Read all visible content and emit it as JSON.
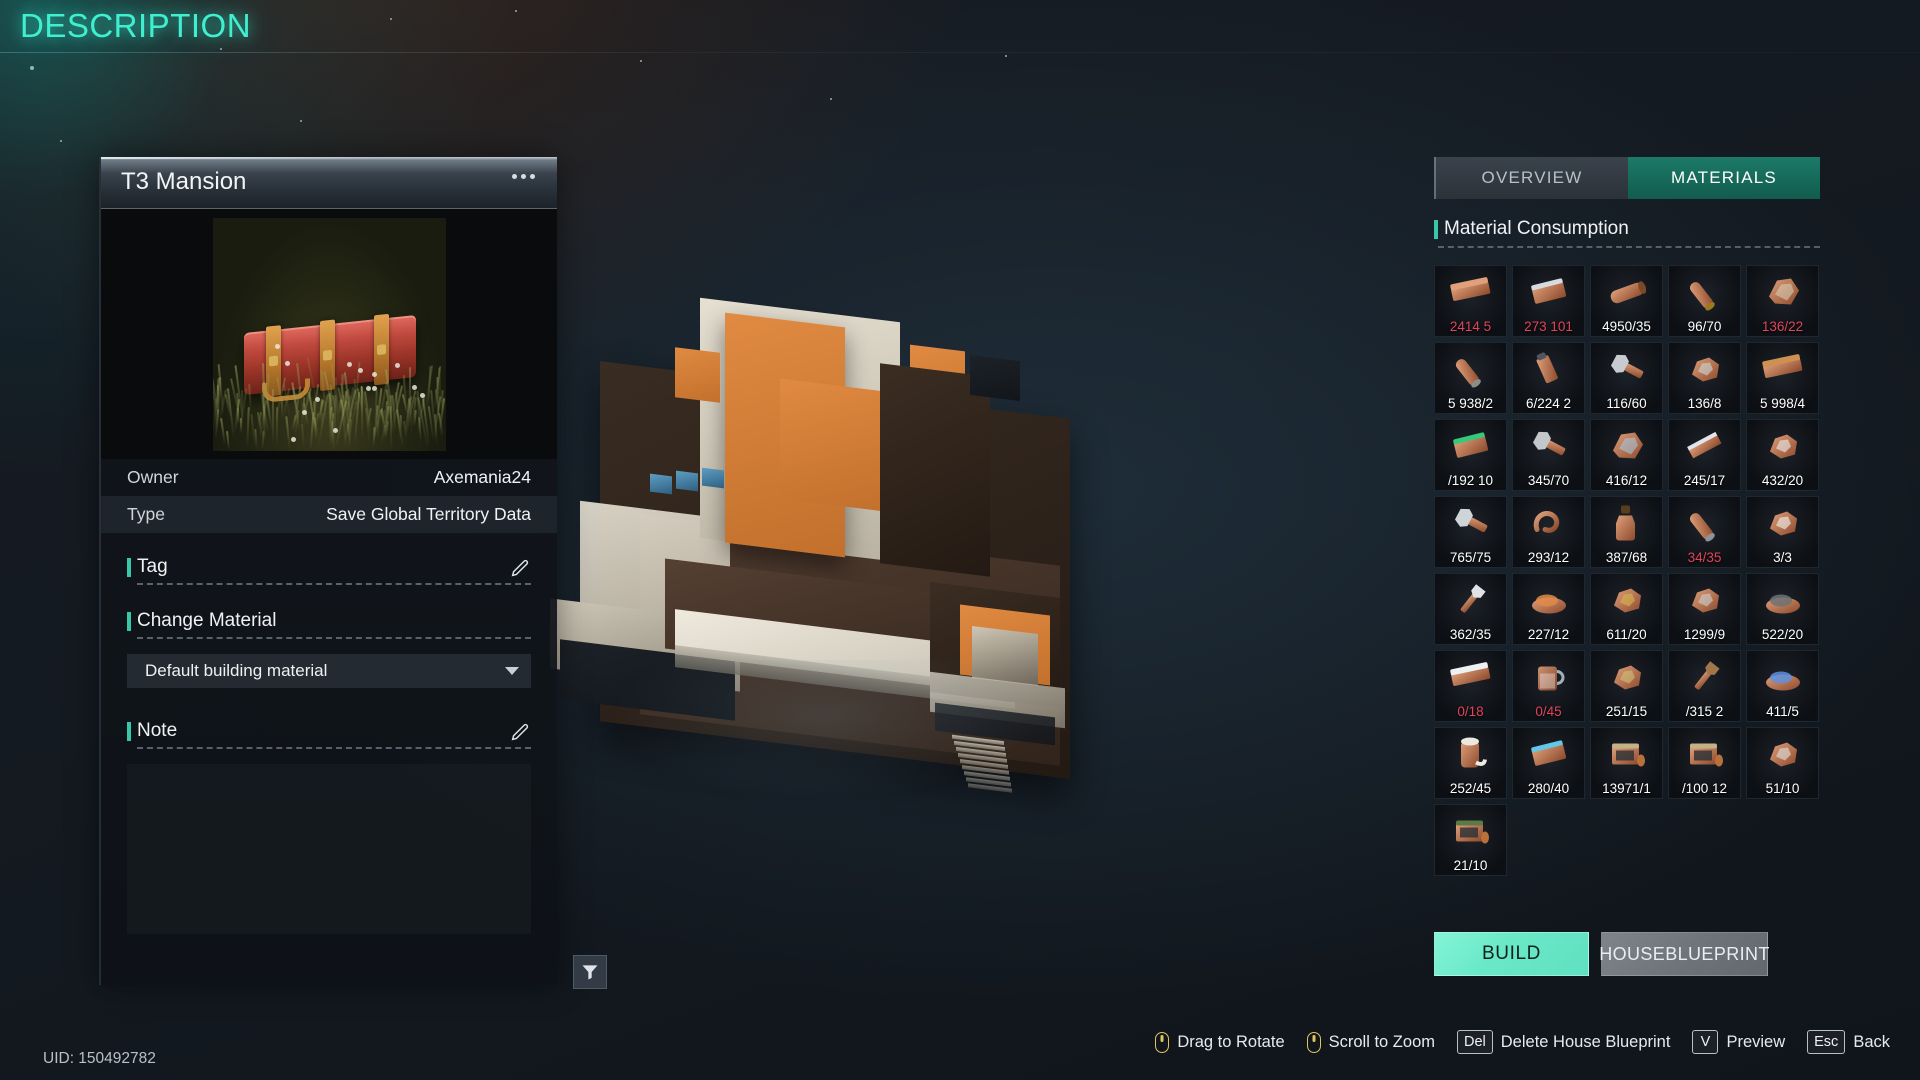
{
  "page": {
    "title": "DESCRIPTION",
    "uid": "UID: 150492782",
    "accent_teal": "#3ff0d0",
    "accent_green": "#38c7a9",
    "low_stock_color": "#e0455c"
  },
  "left_panel": {
    "title": "T3 Mansion",
    "more_icon": "ellipsis-icon",
    "thumbnail_icon": "red-crate-item-image",
    "info_rows": [
      {
        "key": "Owner",
        "value": "Axemania24"
      },
      {
        "key": "Type",
        "value": "Save Global Territory Data"
      }
    ],
    "tag": {
      "label": "Tag",
      "value": "",
      "edit_icon": "pencil-icon"
    },
    "change_material": {
      "label": "Change Material",
      "selected": "Default building material",
      "chevron": "chevron-down-icon"
    },
    "note": {
      "label": "Note",
      "value": "",
      "edit_icon": "pencil-icon"
    },
    "filter_button": {
      "icon": "filter-funnel-icon"
    }
  },
  "right_panel": {
    "tabs": [
      {
        "label": "OVERVIEW",
        "active": false
      },
      {
        "label": "MATERIALS",
        "active": true
      }
    ],
    "section_title": "Material Consumption",
    "materials": [
      {
        "icon": "copper-ingot-icon",
        "qty": "2414  5",
        "low": true,
        "color1": "#e0a07a",
        "color2": "#8c4a2c",
        "shape": "brick"
      },
      {
        "icon": "steel-plate-icon",
        "qty": "273  101",
        "low": true,
        "color1": "#d8dade",
        "color2": "#8f949a",
        "shape": "plate"
      },
      {
        "icon": "wood-log-icon",
        "qty": "4950/35",
        "low": false,
        "color1": "#c78456",
        "color2": "#7a4a26",
        "shape": "log"
      },
      {
        "icon": "brass-rod-icon",
        "qty": "96/70",
        "low": false,
        "color1": "#f0cf6a",
        "color2": "#9a7a1e",
        "shape": "rod"
      },
      {
        "icon": "cloth-fabric-icon",
        "qty": "136/22",
        "low": true,
        "color1": "#d9d6bd",
        "color2": "#8e8b72",
        "shape": "cloth"
      },
      {
        "icon": "aluminum-pipe-icon",
        "qty": "5  938/2",
        "low": false,
        "color1": "#d5d6cf",
        "color2": "#8b8d86",
        "shape": "rod"
      },
      {
        "icon": "grease-tube-icon",
        "qty": "6/224  2",
        "low": false,
        "color1": "#b9c3cb",
        "color2": "#4e565e",
        "shape": "tube"
      },
      {
        "icon": "bolt-icon",
        "qty": "116/60",
        "low": false,
        "color1": "#c8ccd1",
        "color2": "#6e747a",
        "shape": "bolt"
      },
      {
        "icon": "ore-crystal-icon",
        "qty": "136/8",
        "low": false,
        "color1": "#cdd8dc",
        "color2": "#4c5458",
        "shape": "nugget"
      },
      {
        "icon": "bronze-ingot-icon",
        "qty": "5  998/4",
        "low": false,
        "color1": "#cf9152",
        "color2": "#7d4e20",
        "shape": "brick"
      },
      {
        "icon": "circuit-board-icon",
        "qty": "/192  10",
        "low": false,
        "color1": "#36c97b",
        "color2": "#12603a",
        "shape": "plate"
      },
      {
        "icon": "nut-and-bolt-icon",
        "qty": "345/70",
        "low": false,
        "color1": "#c2c7cc",
        "color2": "#666c72",
        "shape": "bolt"
      },
      {
        "icon": "blue-tarp-roll-icon",
        "qty": "416/12",
        "low": false,
        "color1": "#a9cce6",
        "color2": "#4a6d8c",
        "shape": "cloth"
      },
      {
        "icon": "steel-beam-icon",
        "qty": "245/17",
        "low": false,
        "color1": "#e2e6ea",
        "color2": "#878d93",
        "shape": "beam"
      },
      {
        "icon": "silver-scrap-icon",
        "qty": "432/20",
        "low": false,
        "color1": "#eceff2",
        "color2": "#9aa0a6",
        "shape": "nugget"
      },
      {
        "icon": "hinge-bracket-icon",
        "qty": "765/75",
        "low": false,
        "color1": "#cfd4d9",
        "color2": "#6a7076",
        "shape": "bolt"
      },
      {
        "icon": "rubber-hose-icon",
        "qty": "293/12",
        "low": false,
        "color1": "#9aa2a9",
        "color2": "#3e464c",
        "shape": "hose"
      },
      {
        "icon": "chemical-bottle-icon",
        "qty": "387/68",
        "low": false,
        "color1": "#a8763c",
        "color2": "#5a3d1c",
        "shape": "bottle"
      },
      {
        "icon": "titanium-rod-icon",
        "qty": "34/35",
        "low": true,
        "color1": "#e6e9ec",
        "color2": "#8d9399",
        "shape": "rod"
      },
      {
        "icon": "quartz-crystal-icon",
        "qty": "3/3",
        "low": false,
        "color1": "#f3f5f7",
        "color2": "#b6bcc2",
        "shape": "nugget"
      },
      {
        "icon": "wrench-tool-icon",
        "qty": "362/35",
        "low": false,
        "color1": "#dfe3e7",
        "color2": "#7c8288",
        "shape": "tool"
      },
      {
        "icon": "copper-powder-icon",
        "qty": "227/12",
        "low": false,
        "color1": "#e08a4a",
        "color2": "#8c4e1c",
        "shape": "powder"
      },
      {
        "icon": "gold-ore-icon",
        "qty": "611/20",
        "low": false,
        "color1": "#d8b84e",
        "color2": "#6e5a18",
        "shape": "nugget"
      },
      {
        "icon": "stone-icon",
        "qty": "1299/9",
        "low": false,
        "color1": "#ccd2d4",
        "color2": "#7d8386",
        "shape": "nugget"
      },
      {
        "icon": "coal-icon",
        "qty": "522/20",
        "low": false,
        "color1": "#6c7276",
        "color2": "#1c2024",
        "shape": "powder"
      },
      {
        "icon": "metal-ingot-icon",
        "qty": "0/18",
        "low": true,
        "color1": "#eef1f4",
        "color2": "#9ba1a7",
        "shape": "brick"
      },
      {
        "icon": "water-mug-icon",
        "qty": "0/45",
        "low": true,
        "color1": "#dfe8ee",
        "color2": "#9fb0bc",
        "shape": "mug"
      },
      {
        "icon": "sulfur-ore-icon",
        "qty": "251/15",
        "low": false,
        "color1": "#cfc17c",
        "color2": "#776c33",
        "shape": "nugget"
      },
      {
        "icon": "pickaxe-ore-icon",
        "qty": "/315  2",
        "low": false,
        "color1": "#a2764a",
        "color2": "#4b3620",
        "shape": "tool"
      },
      {
        "icon": "cobalt-crystal-icon",
        "qty": "411/5",
        "low": false,
        "color1": "#5f8fe0",
        "color2": "#1f3f84",
        "shape": "powder"
      },
      {
        "icon": "bandage-roll-icon",
        "qty": "252/45",
        "low": false,
        "color1": "#eceadf",
        "color2": "#a49f8e",
        "shape": "roll"
      },
      {
        "icon": "energy-pack-icon",
        "qty": "280/40",
        "low": false,
        "color1": "#63c7e8",
        "color2": "#2a2f6e",
        "shape": "plate"
      },
      {
        "icon": "rifle-ammo-box-icon",
        "qty": "13971/1",
        "low": false,
        "color1": "#c3b287",
        "color2": "#6e6242",
        "shape": "ammo"
      },
      {
        "icon": "pistol-ammo-box-icon",
        "qty": "/100  12",
        "low": false,
        "color1": "#c3b287",
        "color2": "#6e6242",
        "shape": "ammo"
      },
      {
        "icon": "stone-pebbles-icon",
        "qty": "51/10",
        "low": false,
        "color1": "#dfe3e4",
        "color2": "#9aa0a3",
        "shape": "nugget"
      },
      {
        "icon": "ammo-crate-icon",
        "qty": "21/10",
        "low": false,
        "color1": "#5d7a44",
        "color2": "#27361d",
        "shape": "ammo"
      }
    ],
    "build_button": "BUILD",
    "blueprint_button_line1": "HOUSE",
    "blueprint_button_line2": "BLUEPRINT"
  },
  "hints": [
    {
      "key": "",
      "icon": "mouse-drag-icon",
      "label": "Drag to Rotate"
    },
    {
      "key": "",
      "icon": "mouse-scroll-icon",
      "label": "Scroll to Zoom"
    },
    {
      "key": "Del",
      "icon": "",
      "label": "Delete House Blueprint"
    },
    {
      "key": "V",
      "icon": "",
      "label": "Preview"
    },
    {
      "key": "Esc",
      "icon": "",
      "label": "Back"
    }
  ]
}
